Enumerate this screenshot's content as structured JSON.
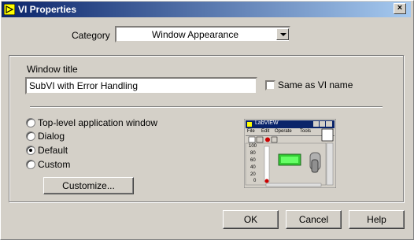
{
  "window": {
    "title": "VI Properties"
  },
  "category": {
    "label": "Category",
    "selected": "Window Appearance"
  },
  "window_title": {
    "label": "Window title",
    "value": "SubVI with Error Handling",
    "same_as_vi_name_label": "Same as VI name",
    "same_as_vi_name_checked": false
  },
  "appearance_options": [
    {
      "label": "Top-level application window",
      "selected": false
    },
    {
      "label": "Dialog",
      "selected": false
    },
    {
      "label": "Default",
      "selected": true
    },
    {
      "label": "Custom",
      "selected": false
    }
  ],
  "customize_button": "Customize...",
  "preview": {
    "window_title": "LabVIEW",
    "menu_items": [
      "File",
      "Edit",
      "Operate",
      "Tools"
    ],
    "scale_labels": [
      "100",
      "80",
      "60",
      "40",
      "20",
      "0"
    ]
  },
  "buttons": {
    "ok": "OK",
    "cancel": "Cancel",
    "help": "Help"
  }
}
